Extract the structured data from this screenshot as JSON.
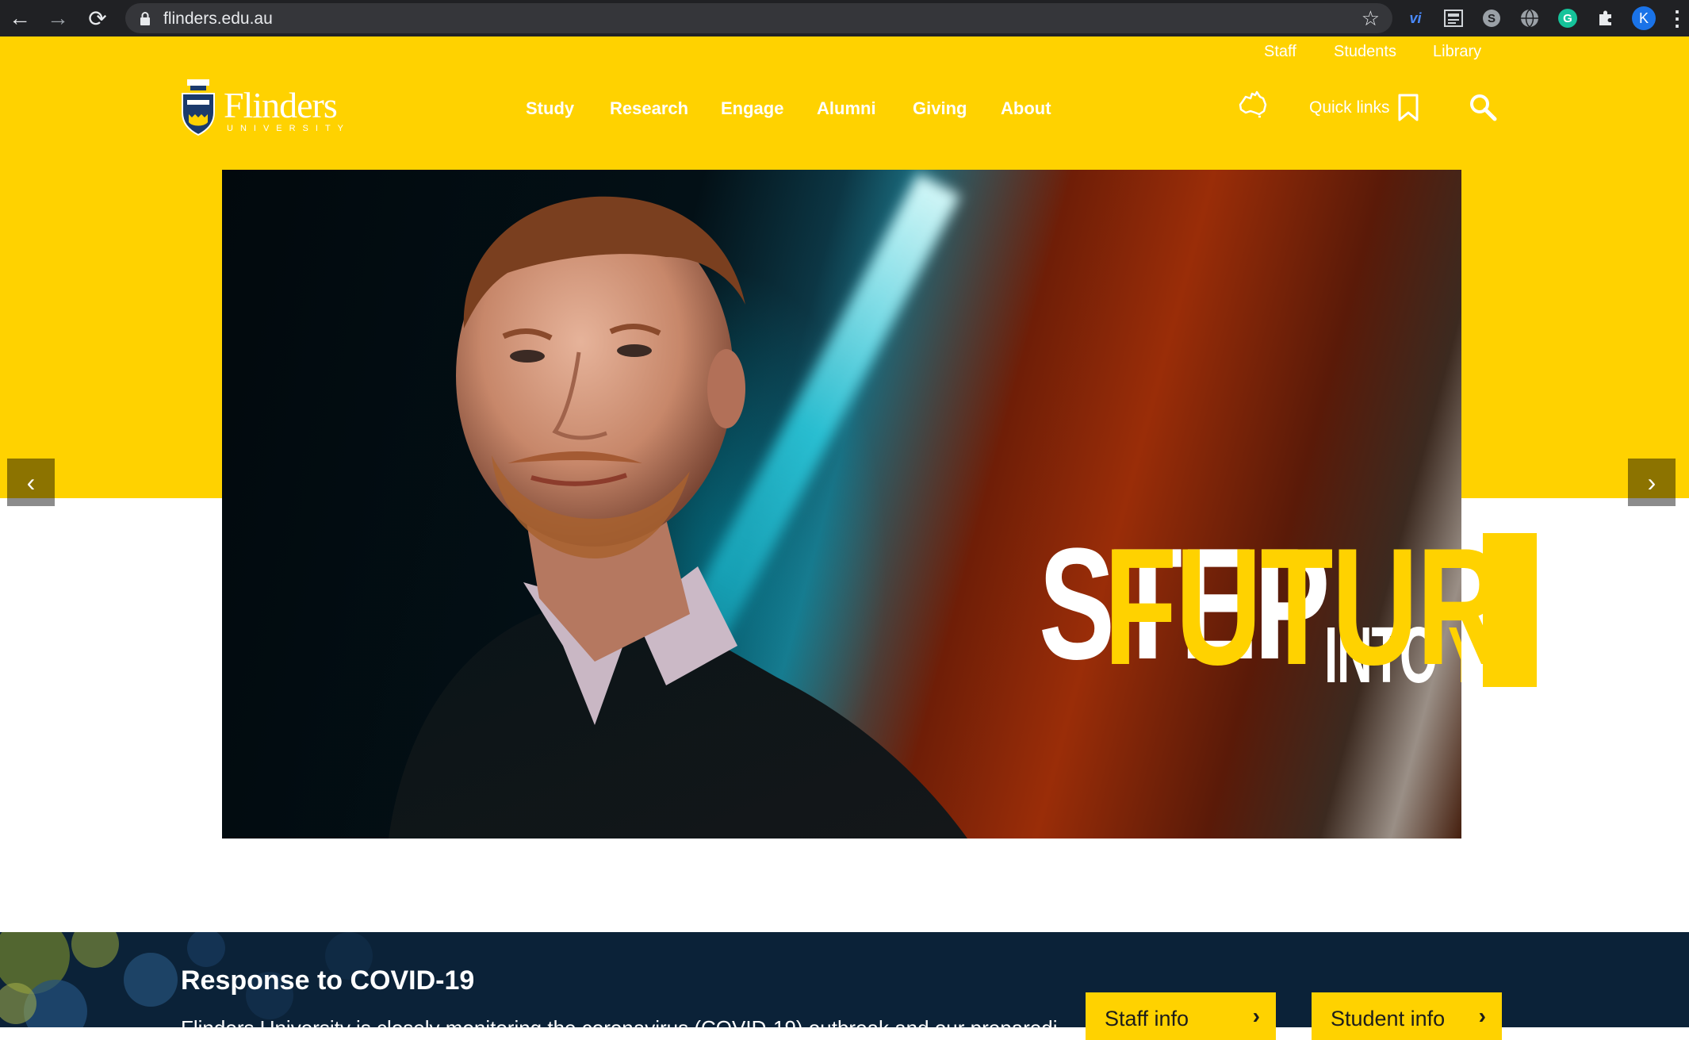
{
  "browser": {
    "url": "flinders.edu.au",
    "profile_initial": "K",
    "extensions": [
      "vi-extension-icon",
      "newspaper-extension-icon",
      "s-extension-icon",
      "globe-extension-icon",
      "grammarly-extension-icon",
      "puzzle-extensions-icon"
    ]
  },
  "utility_nav": [
    "Staff",
    "Students",
    "Library"
  ],
  "logo": {
    "wordmark": "Flinders",
    "sub": "UNIVERSITY"
  },
  "main_nav": [
    "Study",
    "Research",
    "Engage",
    "Alumni",
    "Giving",
    "About"
  ],
  "tools": {
    "quick_links": "Quick links"
  },
  "hero": {
    "headline_line1": "STEP",
    "headline_into": "INTO",
    "headline_your": "YOUR",
    "headline_line2": "FUTUR",
    "accent": "#ffd200"
  },
  "covid": {
    "title": "Response to COVID-19",
    "body": "Flinders University is closely monitoring the coronavirus (COVID-19) outbreak and our preparedi",
    "staff_button": "Staff info",
    "student_button": "Student info"
  },
  "colors": {
    "brand_yellow": "#ffd200",
    "navy": "#0b2238"
  }
}
